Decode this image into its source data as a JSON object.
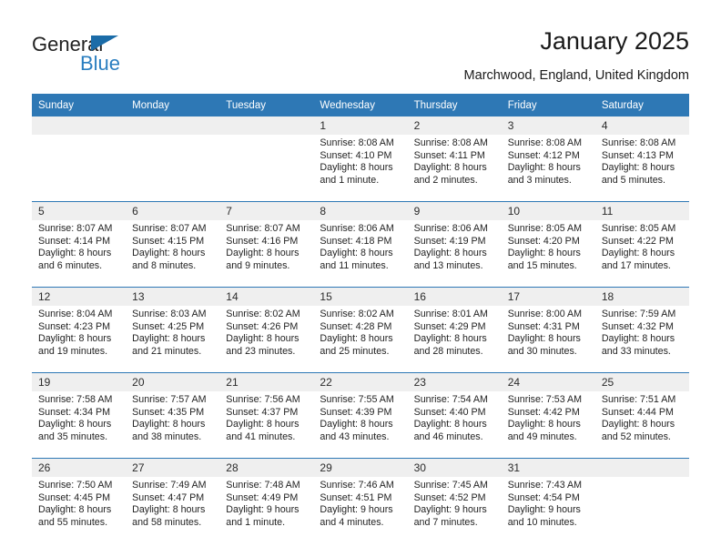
{
  "brand": {
    "name_part1": "General",
    "name_part2": "Blue",
    "triangle_icon": "blue-triangle-icon",
    "color_dark": "#222222",
    "color_blue": "#2a7ec0"
  },
  "header": {
    "title": "January 2025",
    "subtitle": "Marchwood, England, United Kingdom",
    "accent_color": "#2e78b5",
    "daynum_bg": "#efefef"
  },
  "calendar": {
    "weekday_headers": [
      "Sunday",
      "Monday",
      "Tuesday",
      "Wednesday",
      "Thursday",
      "Friday",
      "Saturday"
    ],
    "weeks": [
      [
        {
          "day": "",
          "lines": []
        },
        {
          "day": "",
          "lines": []
        },
        {
          "day": "",
          "lines": []
        },
        {
          "day": "1",
          "lines": [
            "Sunrise: 8:08 AM",
            "Sunset: 4:10 PM",
            "Daylight: 8 hours",
            "and 1 minute."
          ]
        },
        {
          "day": "2",
          "lines": [
            "Sunrise: 8:08 AM",
            "Sunset: 4:11 PM",
            "Daylight: 8 hours",
            "and 2 minutes."
          ]
        },
        {
          "day": "3",
          "lines": [
            "Sunrise: 8:08 AM",
            "Sunset: 4:12 PM",
            "Daylight: 8 hours",
            "and 3 minutes."
          ]
        },
        {
          "day": "4",
          "lines": [
            "Sunrise: 8:08 AM",
            "Sunset: 4:13 PM",
            "Daylight: 8 hours",
            "and 5 minutes."
          ]
        }
      ],
      [
        {
          "day": "5",
          "lines": [
            "Sunrise: 8:07 AM",
            "Sunset: 4:14 PM",
            "Daylight: 8 hours",
            "and 6 minutes."
          ]
        },
        {
          "day": "6",
          "lines": [
            "Sunrise: 8:07 AM",
            "Sunset: 4:15 PM",
            "Daylight: 8 hours",
            "and 8 minutes."
          ]
        },
        {
          "day": "7",
          "lines": [
            "Sunrise: 8:07 AM",
            "Sunset: 4:16 PM",
            "Daylight: 8 hours",
            "and 9 minutes."
          ]
        },
        {
          "day": "8",
          "lines": [
            "Sunrise: 8:06 AM",
            "Sunset: 4:18 PM",
            "Daylight: 8 hours",
            "and 11 minutes."
          ]
        },
        {
          "day": "9",
          "lines": [
            "Sunrise: 8:06 AM",
            "Sunset: 4:19 PM",
            "Daylight: 8 hours",
            "and 13 minutes."
          ]
        },
        {
          "day": "10",
          "lines": [
            "Sunrise: 8:05 AM",
            "Sunset: 4:20 PM",
            "Daylight: 8 hours",
            "and 15 minutes."
          ]
        },
        {
          "day": "11",
          "lines": [
            "Sunrise: 8:05 AM",
            "Sunset: 4:22 PM",
            "Daylight: 8 hours",
            "and 17 minutes."
          ]
        }
      ],
      [
        {
          "day": "12",
          "lines": [
            "Sunrise: 8:04 AM",
            "Sunset: 4:23 PM",
            "Daylight: 8 hours",
            "and 19 minutes."
          ]
        },
        {
          "day": "13",
          "lines": [
            "Sunrise: 8:03 AM",
            "Sunset: 4:25 PM",
            "Daylight: 8 hours",
            "and 21 minutes."
          ]
        },
        {
          "day": "14",
          "lines": [
            "Sunrise: 8:02 AM",
            "Sunset: 4:26 PM",
            "Daylight: 8 hours",
            "and 23 minutes."
          ]
        },
        {
          "day": "15",
          "lines": [
            "Sunrise: 8:02 AM",
            "Sunset: 4:28 PM",
            "Daylight: 8 hours",
            "and 25 minutes."
          ]
        },
        {
          "day": "16",
          "lines": [
            "Sunrise: 8:01 AM",
            "Sunset: 4:29 PM",
            "Daylight: 8 hours",
            "and 28 minutes."
          ]
        },
        {
          "day": "17",
          "lines": [
            "Sunrise: 8:00 AM",
            "Sunset: 4:31 PM",
            "Daylight: 8 hours",
            "and 30 minutes."
          ]
        },
        {
          "day": "18",
          "lines": [
            "Sunrise: 7:59 AM",
            "Sunset: 4:32 PM",
            "Daylight: 8 hours",
            "and 33 minutes."
          ]
        }
      ],
      [
        {
          "day": "19",
          "lines": [
            "Sunrise: 7:58 AM",
            "Sunset: 4:34 PM",
            "Daylight: 8 hours",
            "and 35 minutes."
          ]
        },
        {
          "day": "20",
          "lines": [
            "Sunrise: 7:57 AM",
            "Sunset: 4:35 PM",
            "Daylight: 8 hours",
            "and 38 minutes."
          ]
        },
        {
          "day": "21",
          "lines": [
            "Sunrise: 7:56 AM",
            "Sunset: 4:37 PM",
            "Daylight: 8 hours",
            "and 41 minutes."
          ]
        },
        {
          "day": "22",
          "lines": [
            "Sunrise: 7:55 AM",
            "Sunset: 4:39 PM",
            "Daylight: 8 hours",
            "and 43 minutes."
          ]
        },
        {
          "day": "23",
          "lines": [
            "Sunrise: 7:54 AM",
            "Sunset: 4:40 PM",
            "Daylight: 8 hours",
            "and 46 minutes."
          ]
        },
        {
          "day": "24",
          "lines": [
            "Sunrise: 7:53 AM",
            "Sunset: 4:42 PM",
            "Daylight: 8 hours",
            "and 49 minutes."
          ]
        },
        {
          "day": "25",
          "lines": [
            "Sunrise: 7:51 AM",
            "Sunset: 4:44 PM",
            "Daylight: 8 hours",
            "and 52 minutes."
          ]
        }
      ],
      [
        {
          "day": "26",
          "lines": [
            "Sunrise: 7:50 AM",
            "Sunset: 4:45 PM",
            "Daylight: 8 hours",
            "and 55 minutes."
          ]
        },
        {
          "day": "27",
          "lines": [
            "Sunrise: 7:49 AM",
            "Sunset: 4:47 PM",
            "Daylight: 8 hours",
            "and 58 minutes."
          ]
        },
        {
          "day": "28",
          "lines": [
            "Sunrise: 7:48 AM",
            "Sunset: 4:49 PM",
            "Daylight: 9 hours",
            "and 1 minute."
          ]
        },
        {
          "day": "29",
          "lines": [
            "Sunrise: 7:46 AM",
            "Sunset: 4:51 PM",
            "Daylight: 9 hours",
            "and 4 minutes."
          ]
        },
        {
          "day": "30",
          "lines": [
            "Sunrise: 7:45 AM",
            "Sunset: 4:52 PM",
            "Daylight: 9 hours",
            "and 7 minutes."
          ]
        },
        {
          "day": "31",
          "lines": [
            "Sunrise: 7:43 AM",
            "Sunset: 4:54 PM",
            "Daylight: 9 hours",
            "and 10 minutes."
          ]
        },
        {
          "day": "",
          "lines": []
        }
      ]
    ]
  }
}
